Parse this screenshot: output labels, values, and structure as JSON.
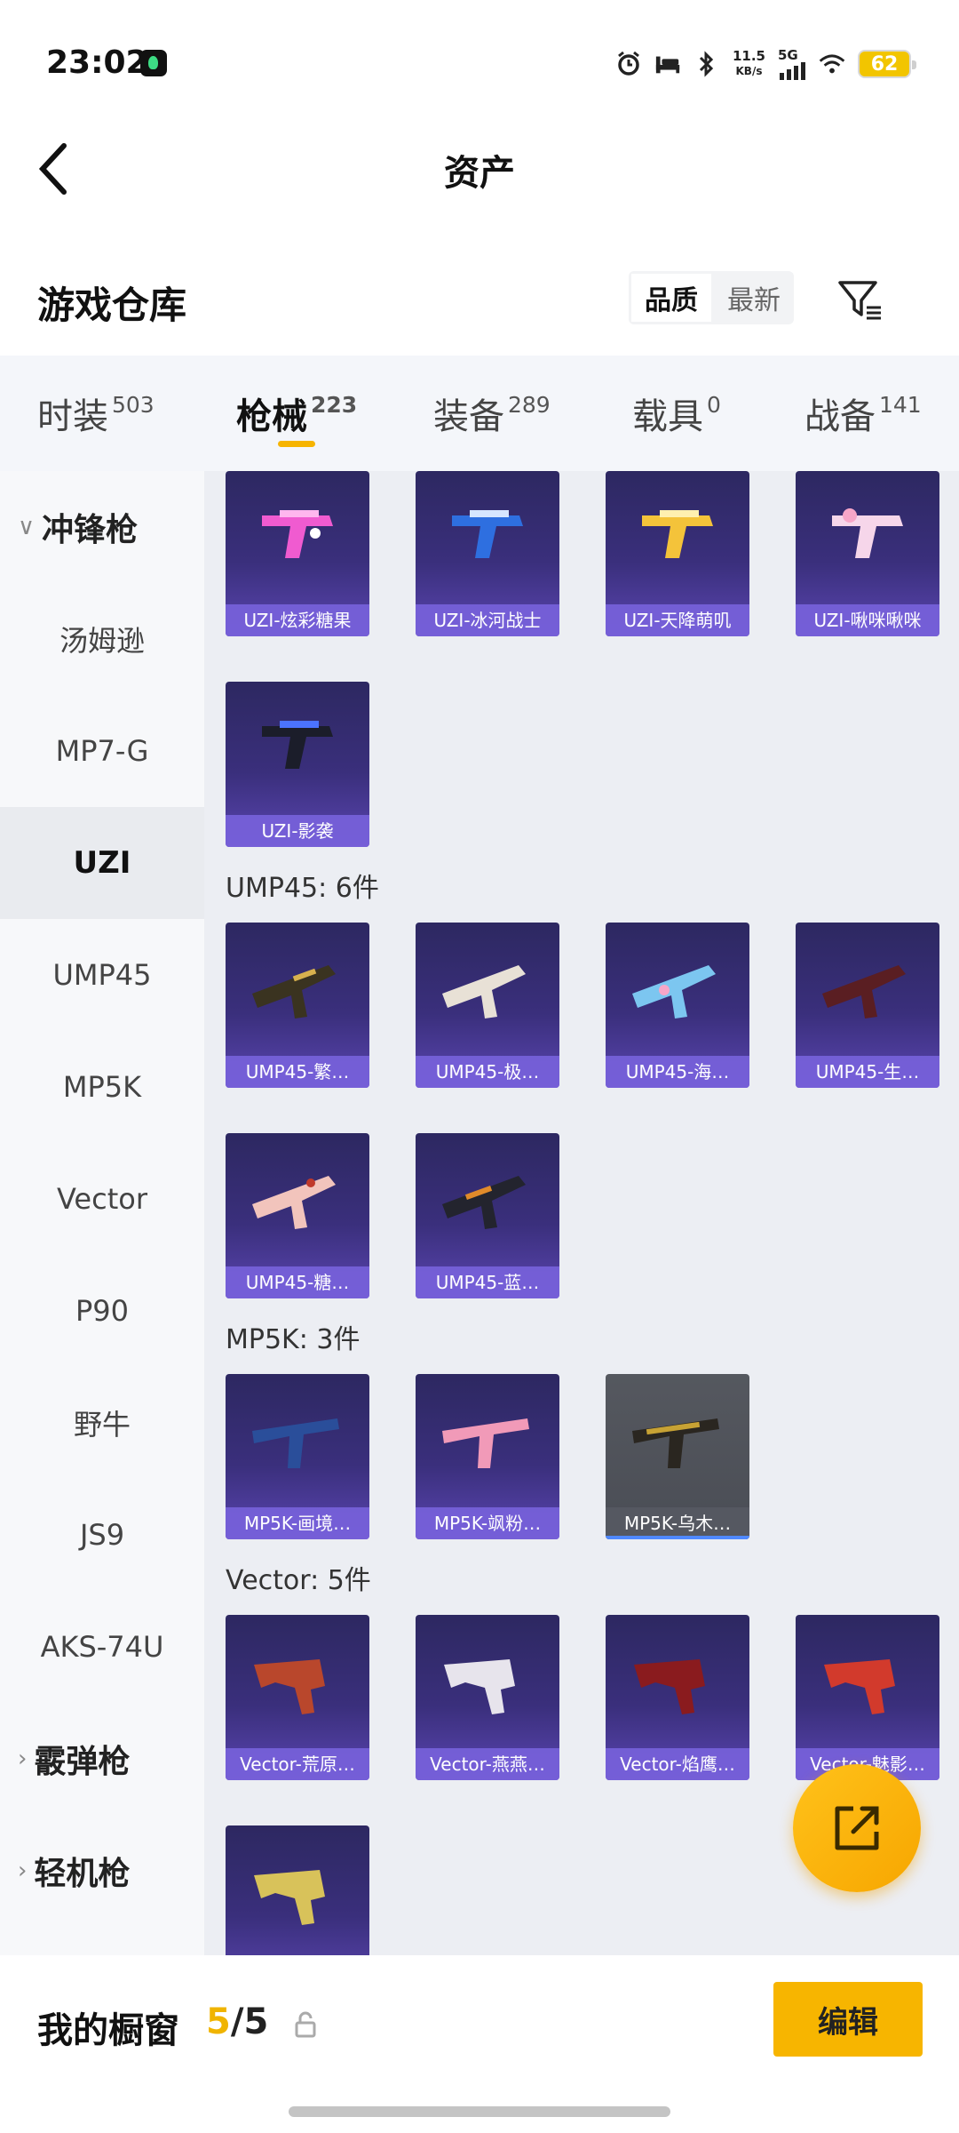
{
  "status_bar": {
    "time": "23:02",
    "speed_value": "11.5",
    "speed_unit": "KB/s",
    "network": "5G",
    "battery": "62",
    "icons": [
      "alarm-icon",
      "bed-icon",
      "bluetooth-icon",
      "signal-icon",
      "wifi-icon"
    ]
  },
  "header": {
    "title": "资产"
  },
  "warehouse": {
    "title": "游戏仓库",
    "sort_options": [
      "品质",
      "最新"
    ],
    "active_sort": "品质"
  },
  "tabs": [
    {
      "label": "时装",
      "count": "503"
    },
    {
      "label": "枪械",
      "count": "223"
    },
    {
      "label": "装备",
      "count": "289"
    },
    {
      "label": "载具",
      "count": "0"
    },
    {
      "label": "战备",
      "count": "141"
    }
  ],
  "active_tab": "枪械",
  "sidebar": {
    "groups": [
      {
        "label": "冲锋枪",
        "expanded": true
      },
      {
        "label": "霰弹枪",
        "expanded": false
      },
      {
        "label": "轻机枪",
        "expanded": false
      }
    ],
    "items": [
      "汤姆逊",
      "MP7-G",
      "UZI",
      "UMP45",
      "MP5K",
      "Vector",
      "P90",
      "野牛",
      "JS9",
      "AKS-74U"
    ],
    "active_item": "UZI"
  },
  "content": {
    "uzi_items": [
      "UZI-炫彩糖果",
      "UZI-冰河战士",
      "UZI-天降萌叽",
      "UZI-啾咪啾咪",
      "UZI-影袭"
    ],
    "ump45_title": "UMP45: 6件",
    "ump45_items": [
      "UMP45-繁…",
      "UMP45-极…",
      "UMP45-海…",
      "UMP45-生…",
      "UMP45-糖…",
      "UMP45-蓝…"
    ],
    "mp5k_title": "MP5K: 3件",
    "mp5k_items": [
      "MP5K-画境…",
      "MP5K-飒粉…",
      "MP5K-乌木…"
    ],
    "vector_title": "Vector: 5件",
    "vector_items": [
      "Vector-荒原…",
      "Vector-燕燕…",
      "Vector-焰鹰…",
      "Vector-魅影…",
      ""
    ]
  },
  "colors": {
    "accent": "#f7b500",
    "card_purple": "#3a2f7c",
    "card_label": "#7862dc"
  },
  "footer": {
    "label": "我的橱窗",
    "current": "5",
    "separator": "/",
    "total": "5",
    "edit_label": "编辑"
  }
}
